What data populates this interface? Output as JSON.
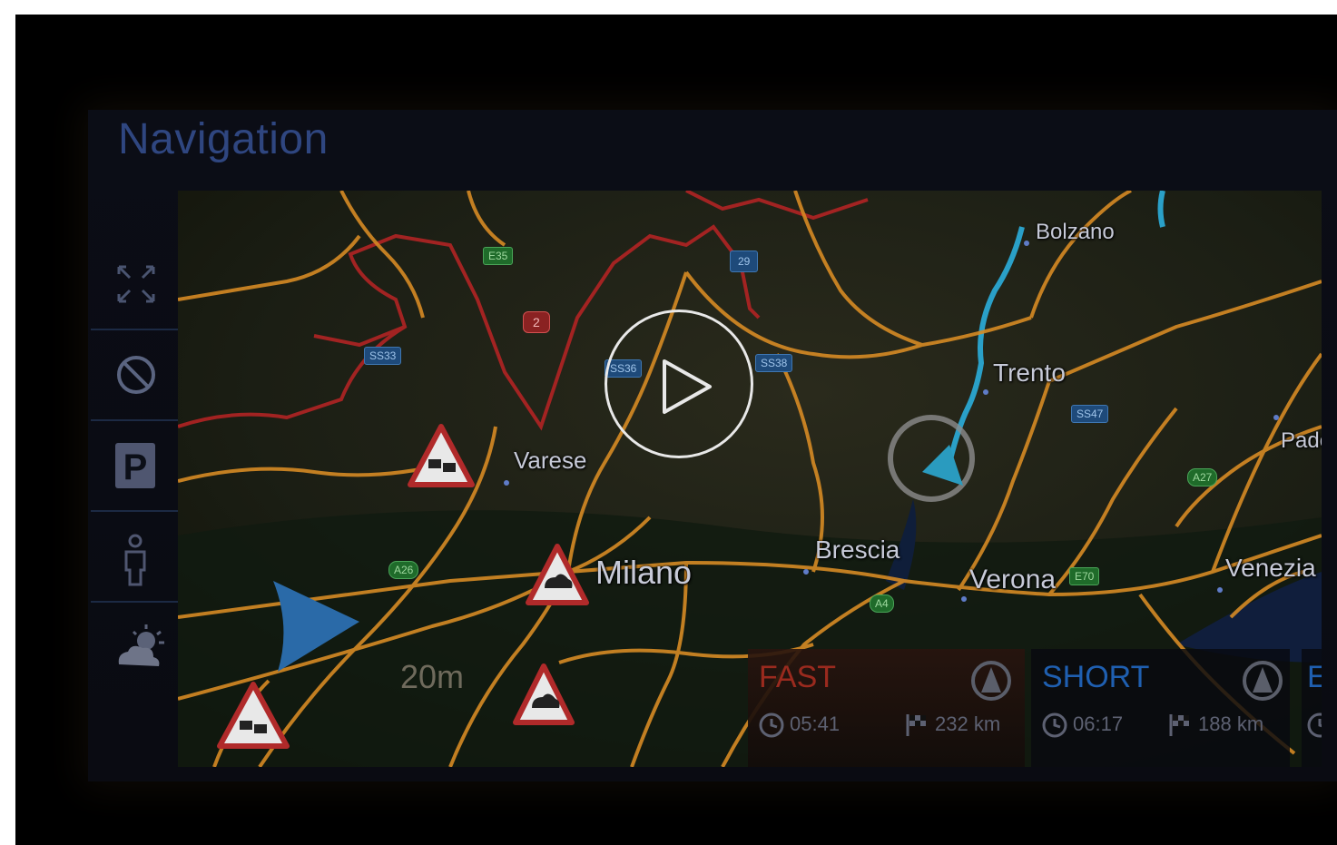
{
  "screen": {
    "title": "Navigation"
  },
  "sidebar": {
    "items": [
      {
        "icon": "expand-arrows-icon"
      },
      {
        "icon": "no-entry-icon"
      },
      {
        "icon": "parking-icon"
      },
      {
        "icon": "person-icon"
      },
      {
        "icon": "weather-icon"
      }
    ]
  },
  "map": {
    "cities": [
      "Bolzano",
      "Trento",
      "Varese",
      "Milano",
      "Brescia",
      "Verona",
      "Venezia",
      "Pado"
    ],
    "road_shields": [
      "E35",
      "2",
      "29",
      "SS33",
      "SS36",
      "SS38",
      "SS47",
      "A26",
      "A4",
      "E70",
      "A27"
    ],
    "scale": "20m"
  },
  "routes": [
    {
      "name": "FAST",
      "time": "05:41",
      "distance": "232 km",
      "color": "#c8301e"
    },
    {
      "name": "SHORT",
      "time": "06:17",
      "distance": "188 km",
      "color": "#1f5fb0"
    },
    {
      "name": "EC",
      "time": "",
      "distance": "",
      "color": "#1f5fb0"
    }
  ],
  "video": {
    "play_icon": "play-icon"
  }
}
